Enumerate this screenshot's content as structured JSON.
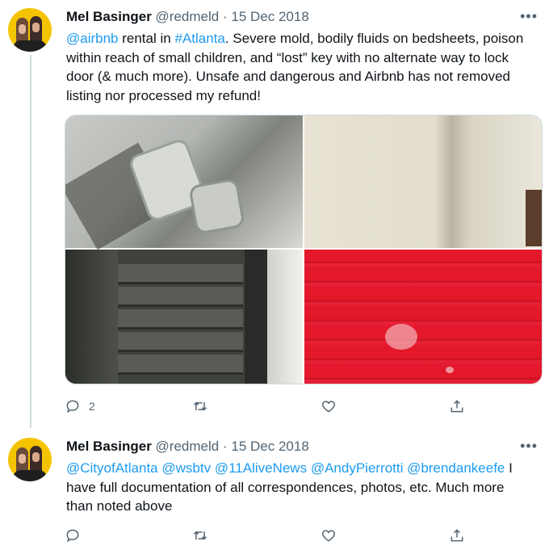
{
  "tweets": [
    {
      "name": "Mel Basinger",
      "handle": "@redmeld",
      "separator": "·",
      "date": "15 Dec 2018",
      "more": "•••",
      "text_parts": [
        {
          "t": "@airbnb",
          "link": true
        },
        {
          "t": " rental in ",
          "link": false
        },
        {
          "t": "#Atlanta",
          "link": true
        },
        {
          "t": ". Severe mold, bodily fluids on bedsheets, poison within reach of small children, and “lost” key with no alternate way to lock door (& much more). Unsafe and dangerous and Airbnb has not removed listing nor processed my refund!",
          "link": false
        }
      ],
      "reply_count": "2",
      "retweet_count": "",
      "like_count": ""
    },
    {
      "name": "Mel Basinger",
      "handle": "@redmeld",
      "separator": "·",
      "date": "15 Dec 2018",
      "more": "•••",
      "text_parts": [
        {
          "t": "@CityofAtlanta",
          "link": true
        },
        {
          "t": " ",
          "link": false
        },
        {
          "t": "@wsbtv",
          "link": true
        },
        {
          "t": " ",
          "link": false
        },
        {
          "t": "@11AliveNews",
          "link": true
        },
        {
          "t": " ",
          "link": false
        },
        {
          "t": "@AndyPierrotti",
          "link": true
        },
        {
          "t": " ",
          "link": false
        },
        {
          "t": "@brendankeefe",
          "link": true
        },
        {
          "t": " I have full documentation of all correspondences, photos, etc. Much more than noted above",
          "link": false
        }
      ],
      "reply_count": "",
      "retweet_count": "",
      "like_count": ""
    }
  ],
  "media": [
    "electrical-outlet-photo",
    "wall-corner-photo",
    "stairway-photo",
    "red-bedsheet-photo"
  ],
  "icons": [
    "reply-icon",
    "retweet-icon",
    "like-icon",
    "share-icon"
  ],
  "colors": {
    "link": "#1d9bf0",
    "secondary": "#536471",
    "text": "#0f1419",
    "thread": "#cfd9de"
  }
}
